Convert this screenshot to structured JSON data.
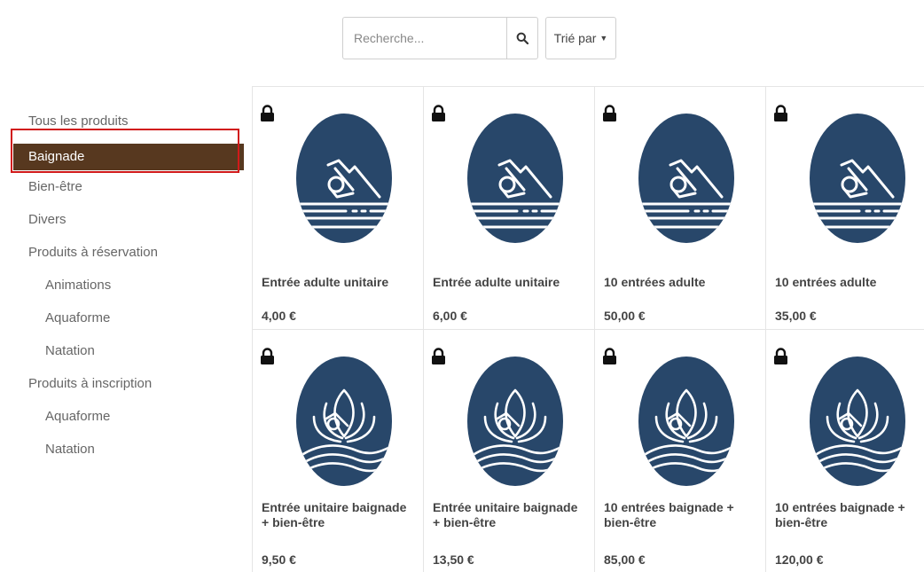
{
  "search": {
    "placeholder": "Recherche..."
  },
  "sort": {
    "label": "Trié par"
  },
  "categories": [
    {
      "label": "Tous les produits"
    },
    {
      "label": "Baignade"
    },
    {
      "label": "Bien-être"
    },
    {
      "label": "Divers"
    },
    {
      "label": "Produits à réservation"
    },
    {
      "label": "Animations"
    },
    {
      "label": "Aquaforme"
    },
    {
      "label": "Natation"
    },
    {
      "label": "Produits à inscription"
    },
    {
      "label": "Aquaforme"
    },
    {
      "label": "Natation"
    }
  ],
  "products": [
    {
      "name": "Entrée adulte unitaire",
      "price": "4,00 €",
      "icon": "swimmer-icon"
    },
    {
      "name": "Entrée adulte unitaire",
      "price": "6,00 €",
      "icon": "swimmer-icon"
    },
    {
      "name": "10 entrées adulte",
      "price": "50,00 €",
      "icon": "swimmer-icon"
    },
    {
      "name": "10 entrées adulte",
      "price": "35,00 €",
      "icon": "swimmer-icon"
    },
    {
      "name": "Entrée unitaire baignade + bien-être",
      "price": "9,50 €",
      "icon": "swimmer-lotus-icon"
    },
    {
      "name": "Entrée unitaire baignade + bien-être",
      "price": "13,50 €",
      "icon": "swimmer-lotus-icon"
    },
    {
      "name": "10 entrées baignade + bien-être",
      "price": "85,00 €",
      "icon": "swimmer-lotus-icon"
    },
    {
      "name": "10 entrées baignade + bien-être",
      "price": "120,00 €",
      "icon": "swimmer-lotus-icon"
    }
  ],
  "colors": {
    "active": "#57381f",
    "highlight": "#d11a1a",
    "icon": "#28476a"
  }
}
